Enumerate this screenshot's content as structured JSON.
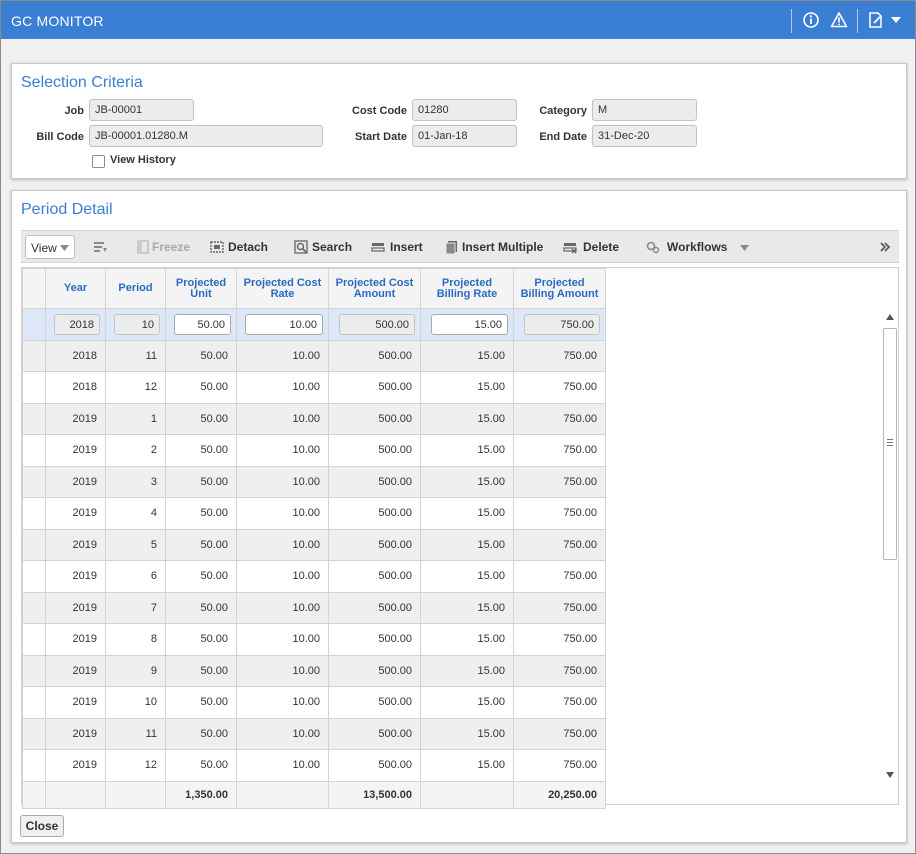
{
  "window": {
    "title": "GC MONITOR"
  },
  "selection_criteria": {
    "title": "Selection Criteria",
    "job_label": "Job",
    "job_value": "JB-00001",
    "bill_code_label": "Bill Code",
    "bill_code_value": "JB-00001.01280.M",
    "view_history_label": "View History",
    "cost_code_label": "Cost Code",
    "cost_code_value": "01280",
    "start_date_label": "Start Date",
    "start_date_value": "01-Jan-18",
    "category_label": "Category",
    "category_value": "M",
    "end_date_label": "End Date",
    "end_date_value": "31-Dec-20"
  },
  "period_detail": {
    "title": "Period Detail",
    "toolbar": {
      "view": "View",
      "freeze": "Freeze",
      "detach": "Detach",
      "search": "Search",
      "insert": "Insert",
      "insert_multiple": "Insert Multiple",
      "delete": "Delete",
      "workflows": "Workflows"
    },
    "columns": {
      "year": "Year",
      "period": "Period",
      "projected_unit": "Projected Unit",
      "projected_cost_rate": "Projected Cost Rate",
      "projected_cost_amount": "Projected Cost Amount",
      "projected_billing_rate": "Projected Billing Rate",
      "projected_billing_amount": "Projected Billing Amount"
    },
    "rows": [
      {
        "year": "2018",
        "period": "10",
        "unit": "50.00",
        "cost_rate": "10.00",
        "cost_amount": "500.00",
        "billing_rate": "15.00",
        "billing_amount": "750.00"
      },
      {
        "year": "2018",
        "period": "11",
        "unit": "50.00",
        "cost_rate": "10.00",
        "cost_amount": "500.00",
        "billing_rate": "15.00",
        "billing_amount": "750.00"
      },
      {
        "year": "2018",
        "period": "12",
        "unit": "50.00",
        "cost_rate": "10.00",
        "cost_amount": "500.00",
        "billing_rate": "15.00",
        "billing_amount": "750.00"
      },
      {
        "year": "2019",
        "period": "1",
        "unit": "50.00",
        "cost_rate": "10.00",
        "cost_amount": "500.00",
        "billing_rate": "15.00",
        "billing_amount": "750.00"
      },
      {
        "year": "2019",
        "period": "2",
        "unit": "50.00",
        "cost_rate": "10.00",
        "cost_amount": "500.00",
        "billing_rate": "15.00",
        "billing_amount": "750.00"
      },
      {
        "year": "2019",
        "period": "3",
        "unit": "50.00",
        "cost_rate": "10.00",
        "cost_amount": "500.00",
        "billing_rate": "15.00",
        "billing_amount": "750.00"
      },
      {
        "year": "2019",
        "period": "4",
        "unit": "50.00",
        "cost_rate": "10.00",
        "cost_amount": "500.00",
        "billing_rate": "15.00",
        "billing_amount": "750.00"
      },
      {
        "year": "2019",
        "period": "5",
        "unit": "50.00",
        "cost_rate": "10.00",
        "cost_amount": "500.00",
        "billing_rate": "15.00",
        "billing_amount": "750.00"
      },
      {
        "year": "2019",
        "period": "6",
        "unit": "50.00",
        "cost_rate": "10.00",
        "cost_amount": "500.00",
        "billing_rate": "15.00",
        "billing_amount": "750.00"
      },
      {
        "year": "2019",
        "period": "7",
        "unit": "50.00",
        "cost_rate": "10.00",
        "cost_amount": "500.00",
        "billing_rate": "15.00",
        "billing_amount": "750.00"
      },
      {
        "year": "2019",
        "period": "8",
        "unit": "50.00",
        "cost_rate": "10.00",
        "cost_amount": "500.00",
        "billing_rate": "15.00",
        "billing_amount": "750.00"
      },
      {
        "year": "2019",
        "period": "9",
        "unit": "50.00",
        "cost_rate": "10.00",
        "cost_amount": "500.00",
        "billing_rate": "15.00",
        "billing_amount": "750.00"
      },
      {
        "year": "2019",
        "period": "10",
        "unit": "50.00",
        "cost_rate": "10.00",
        "cost_amount": "500.00",
        "billing_rate": "15.00",
        "billing_amount": "750.00"
      },
      {
        "year": "2019",
        "period": "11",
        "unit": "50.00",
        "cost_rate": "10.00",
        "cost_amount": "500.00",
        "billing_rate": "15.00",
        "billing_amount": "750.00"
      },
      {
        "year": "2019",
        "period": "12",
        "unit": "50.00",
        "cost_rate": "10.00",
        "cost_amount": "500.00",
        "billing_rate": "15.00",
        "billing_amount": "750.00"
      }
    ],
    "totals": {
      "unit": "1,350.00",
      "cost_amount": "13,500.00",
      "billing_amount": "20,250.00"
    }
  },
  "footer": {
    "close": "Close"
  },
  "colors": {
    "title_bar": "#3b7fd4",
    "heading": "#3b7fd4",
    "column_header": "#2a6bbf",
    "selected_row": "#dce8f8"
  },
  "icons": [
    "info-icon",
    "warning-icon",
    "edit-note-icon",
    "chevron-down-icon",
    "freeze-icon",
    "detach-icon",
    "search-icon",
    "insert-icon",
    "insert-multiple-icon",
    "delete-icon",
    "workflows-icon",
    "expand-icon"
  ]
}
